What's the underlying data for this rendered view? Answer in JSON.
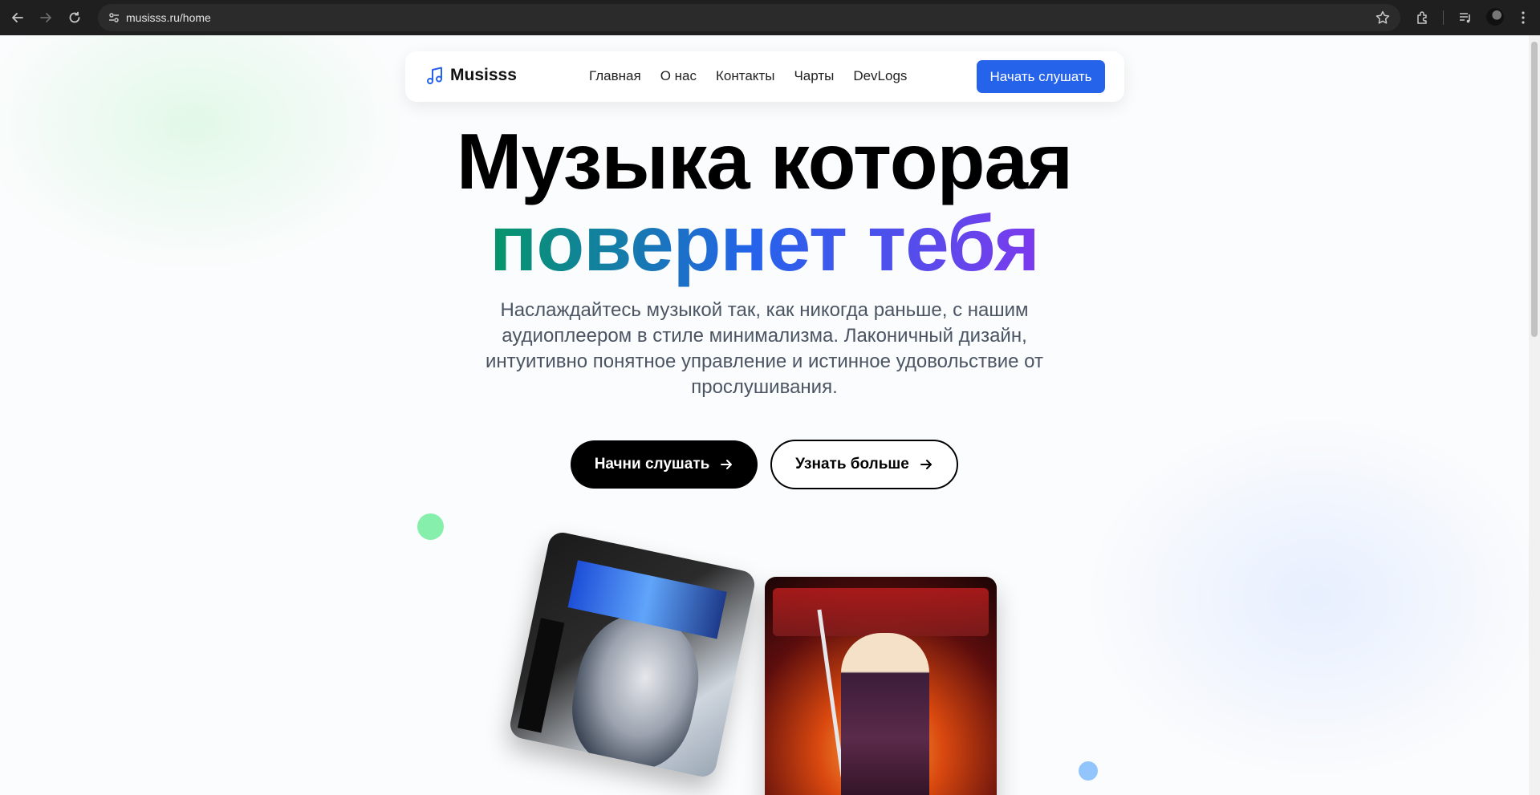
{
  "browser": {
    "url": "musisss.ru/home"
  },
  "nav": {
    "brand": "Musisss",
    "links": [
      "Главная",
      "О нас",
      "Контакты",
      "Чарты",
      "DevLogs"
    ],
    "cta": "Начать слушать"
  },
  "hero": {
    "title_line1": "Музыка которая",
    "title_line2": "повернет тебя",
    "subtitle": "Наслаждайтесь музыкой так, как никогда раньше, с нашим аудиоплеером в стиле минимализма. Лаконичный дизайн, интуитивно понятное управление и истинное удовольствие от прослушивания.",
    "primary_button": "Начни слушать",
    "secondary_button": "Узнать больше"
  },
  "colors": {
    "accent": "#2563eb",
    "gradient_start": "#059669",
    "gradient_mid": "#2563eb",
    "gradient_end": "#7c3aed",
    "dot_green": "#86efac",
    "dot_blue": "#93c5fd"
  },
  "icons": [
    "back-icon",
    "forward-icon",
    "reload-icon",
    "site-settings-icon",
    "bookmark-star-icon",
    "extensions-icon",
    "media-queue-icon",
    "menu-kebab-icon",
    "music-note-icon",
    "arrow-right-icon"
  ]
}
